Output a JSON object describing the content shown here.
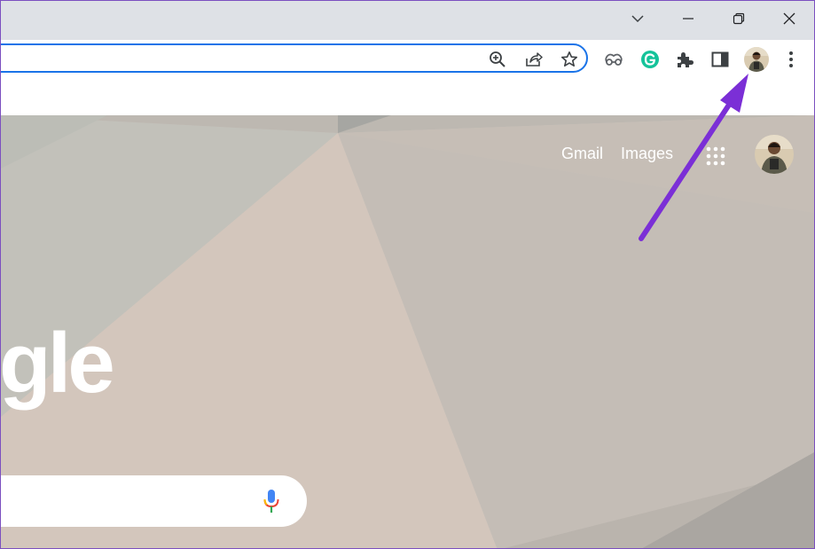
{
  "window_controls": {
    "tab_search": "chevron-down-icon",
    "minimize": "minimize-icon",
    "restore": "restore-icon",
    "close": "close-icon"
  },
  "omnibox": {
    "icons": [
      "zoom-icon",
      "share-icon",
      "bookmark-star-icon"
    ]
  },
  "toolbar_icons": [
    "extension-link-icon",
    "grammarly-icon",
    "puzzle-extensions-icon",
    "side-panel-icon",
    "profile-avatar",
    "more-menu-icon"
  ],
  "google_page": {
    "links": {
      "gmail": "Gmail",
      "images": "Images"
    },
    "logo_partial": "gle",
    "apps_icon": "apps-grid-icon",
    "voice_search_icon": "microphone-icon"
  },
  "annotation": {
    "color": "#7b2fd6"
  },
  "colors": {
    "accent": "#1a73e8",
    "grammarly": "#15c39a",
    "titlebar": "#dee1e6"
  }
}
